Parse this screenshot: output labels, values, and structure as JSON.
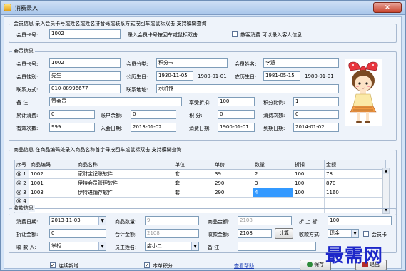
{
  "window": {
    "title": "消费录入",
    "close_glyph": "×"
  },
  "member_search": {
    "group_title": "会员信息 录入会员卡号或姓名或姓名拼音码或联系方式按回车或鼠标双击 支持模糊查询",
    "card_label": "会员卡号:",
    "card_value": "1002",
    "hint": "录入会员卡号按回车或鼠标双击 ...",
    "walkin_label": "散客消费 可以录入客人信息..."
  },
  "member_info": {
    "group_title": "会员信息",
    "card_no_label": "会员卡号:",
    "card_no": "1002",
    "category_label": "会员分类:",
    "category": "积分卡",
    "name_label": "会员姓名:",
    "name": "李遗",
    "gender_label": "会员性别:",
    "gender": "先生",
    "birthday_label": "公历生日:",
    "birthday": "1930-11-05",
    "birthday2": "1980-01-01",
    "lunar_label": "农历生日:",
    "lunar": "1981-05-15",
    "lunar2": "1980-01-01",
    "contact_label": "联系方式:",
    "contact": "010-88996677",
    "address_label": "联系地址:",
    "address": "水浒传",
    "remark_label": "备    注:",
    "remark": "赞会员",
    "discount_label": "享受折扣:",
    "discount": "100",
    "points_ratio_label": "积分比例:",
    "points_ratio": "1",
    "total_spend_label": "累计消费:",
    "total_spend": "0",
    "balance_label": "账户余额:",
    "balance": "0",
    "points_label": "积    分:",
    "points": "0",
    "visit_count_label": "消费次数:",
    "visit_count": "0",
    "valid_count_label": "有效次数:",
    "valid_count": "999",
    "join_date_label": "入会日期:",
    "join_date": "2013-01-02",
    "consume_date_label": "消费日期:",
    "consume_date": "1900-01-01",
    "expire_label": "到期日期:",
    "expire": "2014-01-02"
  },
  "goods": {
    "group_title": "商品信息 在商品编码处录入商品名称首字母按回车或鼠标双击 支持模糊查询",
    "columns": [
      "序号",
      "商品编码",
      "商品名称",
      "单位",
      "单价",
      "数量",
      "折扣",
      "金额"
    ],
    "rows": [
      [
        "@ 1",
        "1002",
        "家财宝记账软件",
        "套",
        "39",
        "2",
        "100",
        "78"
      ],
      [
        "@ 2",
        "1001",
        "伊特会员管理软件",
        "套",
        "290",
        "3",
        "100",
        "870"
      ],
      [
        "@ 3",
        "1003",
        "伊特进销存软件",
        "套",
        "290",
        "4",
        "100",
        "1160"
      ],
      [
        "@ 4",
        "",
        "",
        "",
        "",
        "",
        "",
        ""
      ],
      [
        "@ 5",
        "",
        "",
        "",
        "",
        "",
        "",
        ""
      ]
    ]
  },
  "checkout": {
    "group_title": "收款信息",
    "date_label": "消费日期:",
    "date": "2013-11-03",
    "qty_label": "商品数量:",
    "qty": "9",
    "amount_label": "商品金额:",
    "amount": "2108",
    "discount_label": "折 上 折:",
    "discount": "100",
    "discount_amt_label": "折让金额:",
    "discount_amt": "0",
    "total_label": "合计金额:",
    "total": "2108",
    "received_label": "收款金额:",
    "received": "2108",
    "calc_button": "计算",
    "method_label": "收款方式:",
    "method": "现金",
    "member_card_label": "会员卡",
    "payee_label": "收 款 人:",
    "payee": "掌柜",
    "staff_label": "员工姓名:",
    "staff": "店小二",
    "remark_label": "备    注:"
  },
  "footer": {
    "continuous_label": "连续新增",
    "points_label": "本单积分",
    "help_link": "查看帮助",
    "save_button": "保存",
    "exit_button": "退出"
  },
  "watermark": "最需网",
  "colors": {
    "selected_cell": "#3399ff",
    "window_frame": "#d4e4f7",
    "watermark": "#1d27c9"
  }
}
